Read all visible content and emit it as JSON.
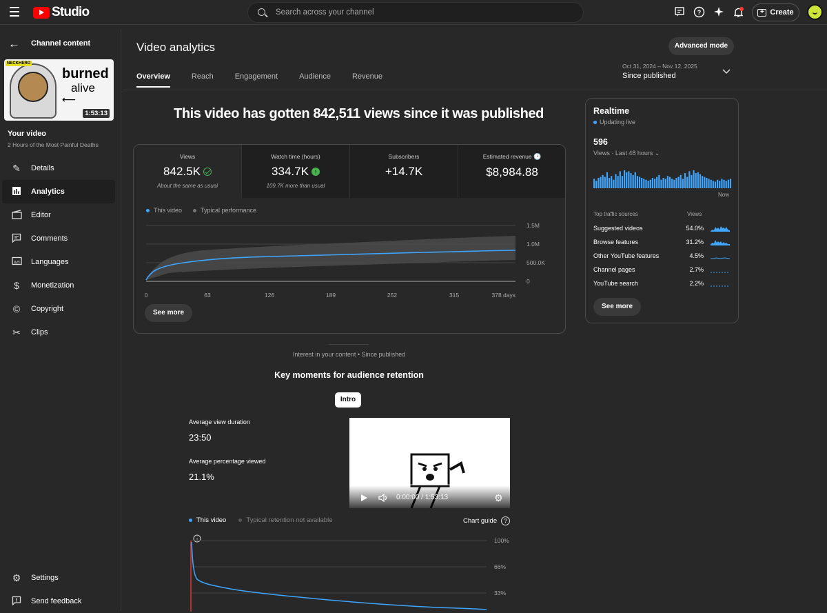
{
  "header": {
    "brand": "Studio",
    "search_placeholder": "Search across your channel",
    "create_label": "Create"
  },
  "sidebar": {
    "title": "Channel content",
    "thumbnail": {
      "badge": "NECKHERO",
      "line1": "burned",
      "line2": "alive",
      "duration": "1:53:13"
    },
    "your_video_label": "Your video",
    "video_title": "2 Hours of the Most Painful Deaths",
    "items": [
      {
        "label": "Details",
        "icon": "pencil-icon"
      },
      {
        "label": "Analytics",
        "icon": "analytics-icon"
      },
      {
        "label": "Editor",
        "icon": "editor-icon"
      },
      {
        "label": "Comments",
        "icon": "comments-icon"
      },
      {
        "label": "Languages",
        "icon": "subtitles-icon"
      },
      {
        "label": "Monetization",
        "icon": "dollar-icon"
      },
      {
        "label": "Copyright",
        "icon": "copyright-icon"
      },
      {
        "label": "Clips",
        "icon": "scissors-icon"
      }
    ],
    "footer": [
      {
        "label": "Settings",
        "icon": "gear-icon"
      },
      {
        "label": "Send feedback",
        "icon": "feedback-icon"
      }
    ]
  },
  "page": {
    "title": "Video analytics",
    "advanced_mode": "Advanced mode",
    "tabs": [
      "Overview",
      "Reach",
      "Engagement",
      "Audience",
      "Revenue"
    ],
    "date_range": "Oct 31, 2024 – Nov 12, 2025",
    "date_label": "Since published",
    "headline": "This video has gotten 842,511 views since it was published"
  },
  "metrics": [
    {
      "label": "Views",
      "value": "842.5K",
      "sub": "About the same as usual"
    },
    {
      "label": "Watch time (hours)",
      "value": "334.7K",
      "sub": "109.7K more than usual"
    },
    {
      "label": "Subscribers",
      "value": "+14.7K",
      "sub": ""
    },
    {
      "label": "Estimated revenue",
      "value": "$8,984.88",
      "sub": ""
    }
  ],
  "views_chart": {
    "legend": [
      "This video",
      "Typical performance"
    ],
    "x_ticks": [
      "0",
      "63",
      "126",
      "189",
      "252",
      "315",
      "378 days"
    ],
    "y_ticks": [
      "1.5M",
      "1.0M",
      "500.0K",
      "0"
    ],
    "see_more": "See more"
  },
  "realtime": {
    "title": "Realtime",
    "status": "Updating live",
    "count": "596",
    "period": "Views · Last 48 hours",
    "now_label": "Now",
    "bars": [
      10,
      8,
      11,
      12,
      14,
      12,
      17,
      11,
      13,
      9,
      15,
      13,
      18,
      13,
      19,
      17,
      18,
      16,
      14,
      17,
      13,
      12,
      11,
      10,
      9,
      8,
      9,
      11,
      10,
      12,
      14,
      9,
      11,
      10,
      13,
      12,
      10,
      9,
      11,
      12,
      14,
      10,
      16,
      12,
      18,
      14,
      19,
      16,
      17,
      15,
      13,
      12,
      11,
      10,
      9,
      8,
      7,
      9,
      8,
      10,
      9,
      8,
      9,
      10
    ],
    "traffic_header": "Top traffic sources",
    "views_header": "Views",
    "sources": [
      {
        "name": "Suggested videos",
        "pct": "54.0%"
      },
      {
        "name": "Browse features",
        "pct": "31.2%"
      },
      {
        "name": "Other YouTube features",
        "pct": "4.5%"
      },
      {
        "name": "Channel pages",
        "pct": "2.7%"
      },
      {
        "name": "YouTube search",
        "pct": "2.2%"
      }
    ],
    "see_more": "See more"
  },
  "retention": {
    "interest_label": "Interest in your content • Since published",
    "title": "Key moments for audience retention",
    "chip": "Intro",
    "avg_duration_label": "Average view duration",
    "avg_duration": "23:50",
    "avg_pct_label": "Average percentage viewed",
    "avg_pct": "21.1%",
    "player_time": "0:00:00 / 1:53:13",
    "legend": [
      "This video",
      "Typical retention not available"
    ],
    "chart_guide": "Chart guide",
    "y_ticks": [
      "100%",
      "66%",
      "33%"
    ]
  },
  "colors": {
    "accent": "#3ea6ff",
    "brand": "#ff0000",
    "positive": "#48b24f"
  }
}
